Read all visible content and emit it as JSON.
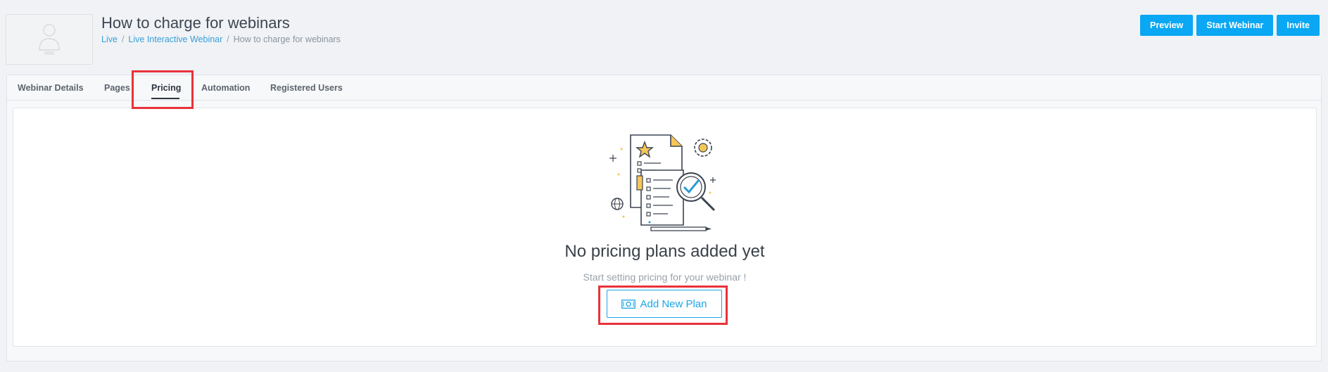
{
  "header": {
    "title": "How to charge for webinars",
    "thumbnail_icon": "user-placeholder-icon"
  },
  "breadcrumb": {
    "items": [
      "Live",
      "Live Interactive Webinar",
      "How to charge for webinars"
    ],
    "separator": "/"
  },
  "actions": {
    "preview_label": "Preview",
    "start_label": "Start Webinar",
    "invite_label": "Invite"
  },
  "tabs": [
    {
      "label": "Webinar Details",
      "active": false
    },
    {
      "label": "Pages",
      "active": false
    },
    {
      "label": "Pricing",
      "active": true
    },
    {
      "label": "Automation",
      "active": false
    },
    {
      "label": "Registered Users",
      "active": false
    }
  ],
  "empty_state": {
    "illustration_icon": "document-checklist-illustration",
    "title": "No pricing plans added yet",
    "subtitle": "Start setting pricing for your webinar !",
    "button_label": "Add New Plan",
    "button_icon": "money-bill-icon"
  },
  "colors": {
    "accent": "#0aa7f4",
    "highlight": "#e8323a"
  }
}
